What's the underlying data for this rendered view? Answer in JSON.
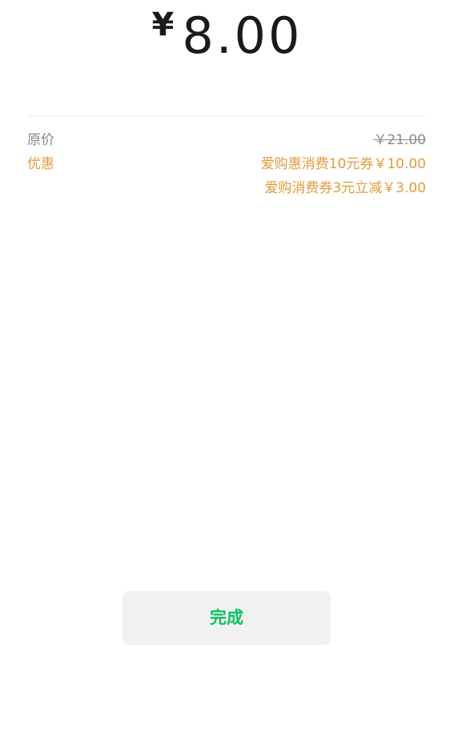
{
  "payment": {
    "currency_symbol": "¥",
    "amount": "8.00"
  },
  "details": {
    "original_label": "原价",
    "original_value": "￥21.00",
    "discount_label": "优惠",
    "discounts": [
      "爱购惠消费10元券￥10.00",
      "爱购消费券3元立减￥3.00"
    ]
  },
  "actions": {
    "done_label": "完成"
  },
  "colors": {
    "accent_green": "#07c160",
    "discount_orange": "#e39b3c",
    "muted_gray": "#8a8a8a"
  }
}
